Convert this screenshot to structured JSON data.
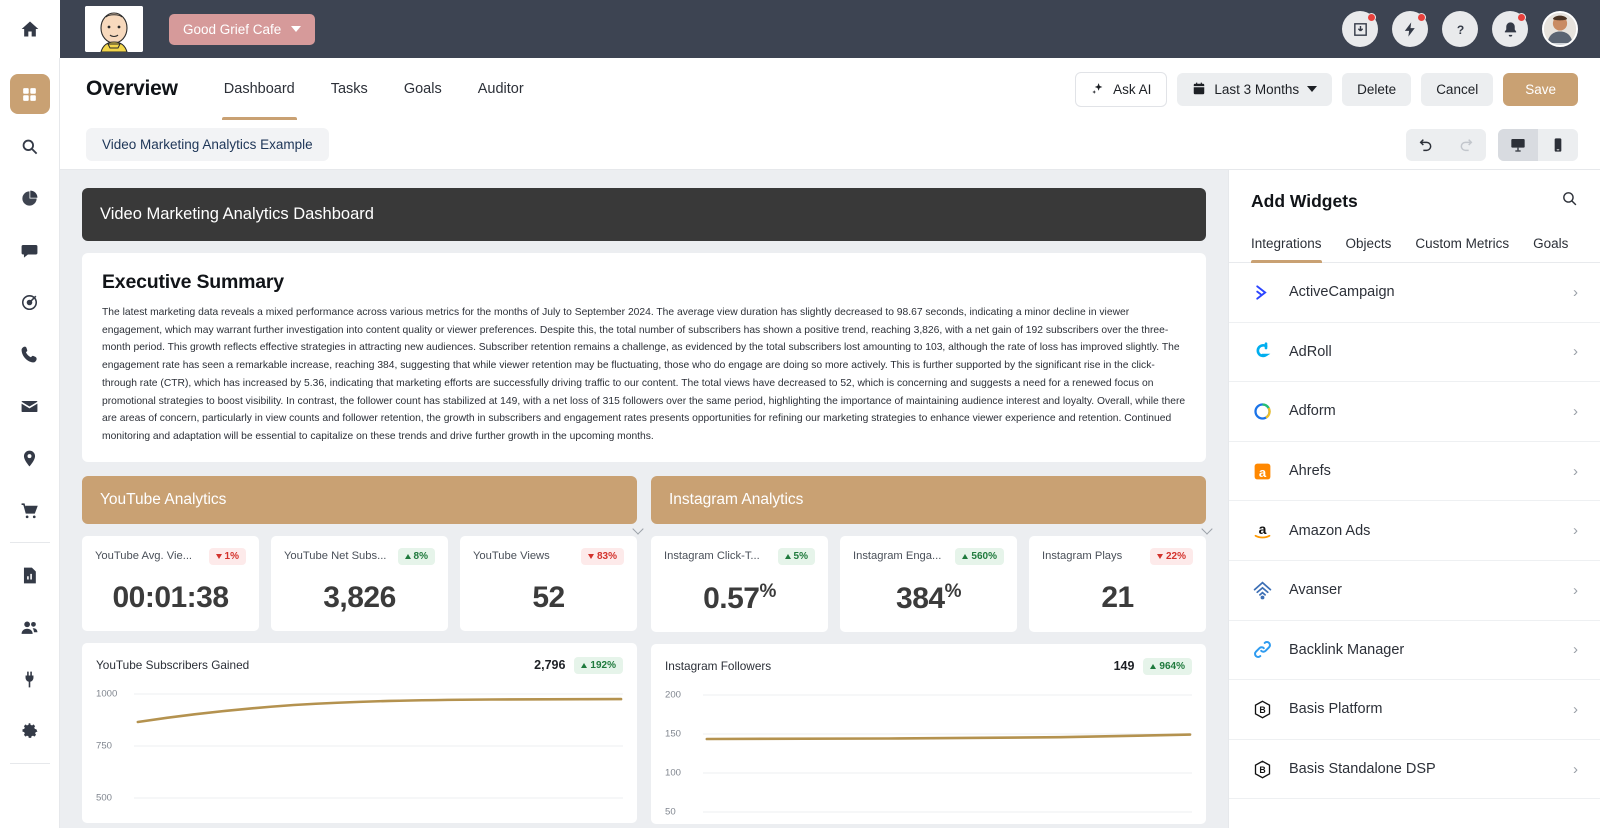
{
  "topbar": {
    "account_name": "Good Grief Cafe",
    "icons": [
      {
        "name": "import-icon",
        "badge": true
      },
      {
        "name": "bolt-icon",
        "badge": true
      },
      {
        "name": "help-icon",
        "badge": false
      },
      {
        "name": "bell-icon",
        "badge": true
      }
    ],
    "avatar_name": "user-avatar",
    "home_icon": "home-icon"
  },
  "rail": {
    "items": [
      {
        "name": "dashboard-grid-icon",
        "active": true
      },
      {
        "name": "search-icon",
        "active": false
      },
      {
        "name": "pie-chart-icon",
        "active": false
      },
      {
        "name": "chat-bubble-icon",
        "active": false
      },
      {
        "name": "target-icon",
        "active": false
      },
      {
        "name": "phone-icon",
        "active": false
      },
      {
        "name": "envelope-icon",
        "active": false
      },
      {
        "name": "location-pin-icon",
        "active": false
      },
      {
        "name": "shopping-cart-icon",
        "active": false
      }
    ],
    "items2": [
      {
        "name": "report-document-icon",
        "active": false
      },
      {
        "name": "users-icon",
        "active": false
      },
      {
        "name": "plug-icon",
        "active": false
      },
      {
        "name": "gear-icon",
        "active": false
      }
    ]
  },
  "header": {
    "title": "Overview",
    "tabs": [
      {
        "label": "Dashboard",
        "active": true
      },
      {
        "label": "Tasks",
        "active": false
      },
      {
        "label": "Goals",
        "active": false
      },
      {
        "label": "Auditor",
        "active": false
      }
    ],
    "ask_ai_label": "Ask AI",
    "date_range_label": "Last 3 Months",
    "delete_label": "Delete",
    "cancel_label": "Cancel",
    "save_label": "Save"
  },
  "subbar": {
    "dashboard_name": "Video Marketing Analytics Example",
    "undo_icon": "undo-icon",
    "redo_icon": "redo-icon",
    "desktop_icon": "desktop-icon",
    "mobile_icon": "mobile-icon"
  },
  "dashboard": {
    "title": "Video Marketing Analytics Dashboard",
    "exec_heading": "Executive Summary",
    "exec_body": "The latest marketing data reveals a mixed performance across various metrics for the months of July to September 2024. The average view duration has slightly decreased to 98.67 seconds, indicating a minor decline in viewer engagement, which may warrant further investigation into content quality or viewer preferences. Despite this, the total number of subscribers has shown a positive trend, reaching 3,826, with a net gain of 192 subscribers over the three-month period. This growth reflects effective strategies in attracting new audiences. Subscriber retention remains a challenge, as evidenced by the total subscribers lost amounting to 103, although the rate of loss has improved slightly. The engagement rate has seen a remarkable increase, reaching 384, suggesting that while viewer retention may be fluctuating, those who do engage are doing so more actively. This is further supported by the significant rise in the click-through rate (CTR), which has increased by 5.36, indicating that marketing efforts are successfully driving traffic to our content. The total views have decreased to 52, which is concerning and suggests a need for a renewed focus on promotional strategies to boost visibility. In contrast, the follower count has stabilized at 149, with a net loss of 315 followers over the same period, highlighting the importance of maintaining audience interest and loyalty. Overall, while there are areas of concern, particularly in view counts and follower retention, the growth in subscribers and engagement rates presents opportunities for refining our marketing strategies to enhance viewer experience and retention. Continued monitoring and adaptation will be essential to capitalize on these trends and drive further growth in the upcoming months.",
    "sections": [
      {
        "banner": "YouTube Analytics",
        "kpis": [
          {
            "label": "YouTube Avg. Vie...",
            "value": "00:01:38",
            "sup": "",
            "delta": "1%",
            "dir": "down"
          },
          {
            "label": "YouTube Net Subs...",
            "value": "3,826",
            "sup": "",
            "delta": "8%",
            "dir": "up"
          },
          {
            "label": "YouTube Views",
            "value": "52",
            "sup": "",
            "delta": "83%",
            "dir": "down"
          }
        ],
        "chart": {
          "title": "YouTube Subscribers Gained",
          "total": "2,796",
          "delta": "192%",
          "dir": "up"
        }
      },
      {
        "banner": "Instagram Analytics",
        "kpis": [
          {
            "label": "Instagram Click-T...",
            "value": "0.57",
            "sup": "%",
            "delta": "5%",
            "dir": "up"
          },
          {
            "label": "Instagram Enga...",
            "value": "384",
            "sup": "%",
            "delta": "560%",
            "dir": "up"
          },
          {
            "label": "Instagram Plays",
            "value": "21",
            "sup": "",
            "delta": "22%",
            "dir": "down"
          }
        ],
        "chart": {
          "title": "Instagram Followers",
          "total": "149",
          "delta": "964%",
          "dir": "up"
        }
      }
    ]
  },
  "chart_data": [
    {
      "type": "line",
      "title": "YouTube Subscribers Gained",
      "total": "2,796",
      "change": "192%",
      "ylabel": "",
      "xlabel": "",
      "yticks": [
        1000,
        750,
        500
      ],
      "ylim": [
        500,
        1075
      ],
      "x": [
        0,
        1,
        2,
        3,
        4,
        5,
        6,
        7,
        8,
        9,
        10
      ],
      "values": [
        862,
        889,
        908,
        925,
        938,
        949,
        955,
        957,
        958,
        959,
        960
      ],
      "line_color": "#b4924f",
      "grid": true,
      "legend": "none"
    },
    {
      "type": "line",
      "title": "Instagram Followers",
      "total": "149",
      "change": "964%",
      "ylabel": "",
      "xlabel": "",
      "yticks": [
        200,
        150,
        100,
        50
      ],
      "ylim": [
        40,
        215
      ],
      "x": [
        0,
        1,
        2,
        3,
        4,
        5,
        6,
        7,
        8,
        9,
        10
      ],
      "values": [
        144,
        144,
        144,
        144,
        145,
        145,
        145,
        146,
        147,
        148,
        149
      ],
      "line_color": "#b4924f",
      "grid": true,
      "legend": "none"
    }
  ],
  "widgets": {
    "title": "Add Widgets",
    "search_icon": "search-icon",
    "tabs": [
      {
        "label": "Integrations",
        "active": true
      },
      {
        "label": "Objects",
        "active": false
      },
      {
        "label": "Custom Metrics",
        "active": false
      },
      {
        "label": "Goals",
        "active": false
      }
    ],
    "items": [
      {
        "label": "ActiveCampaign",
        "icon": "activecampaign-icon",
        "color": "#2b44ff"
      },
      {
        "label": "AdRoll",
        "icon": "adroll-icon",
        "color": "#00aeef"
      },
      {
        "label": "Adform",
        "icon": "adform-icon",
        "color": "#1a73e8"
      },
      {
        "label": "Ahrefs",
        "icon": "ahrefs-icon",
        "color": "#ff8800"
      },
      {
        "label": "Amazon Ads",
        "icon": "amazon-ads-icon",
        "color": "#111111"
      },
      {
        "label": "Avanser",
        "icon": "avanser-icon",
        "color": "#3d6fb5"
      },
      {
        "label": "Backlink Manager",
        "icon": "backlink-manager-icon",
        "color": "#2e9bf0"
      },
      {
        "label": "Basis Platform",
        "icon": "basis-platform-icon",
        "color": "#111111"
      },
      {
        "label": "Basis Standalone DSP",
        "icon": "basis-standalone-dsp-icon",
        "color": "#111111"
      }
    ],
    "chevron": "›"
  },
  "colors": {
    "accent": "#c9a173",
    "topbar_bg": "#3d4452",
    "canvas_bg": "#eceef1",
    "dash_header_bg": "#393939",
    "account_pill": "#d69a9a",
    "up": "#1f7a3d",
    "down": "#d3322c"
  }
}
